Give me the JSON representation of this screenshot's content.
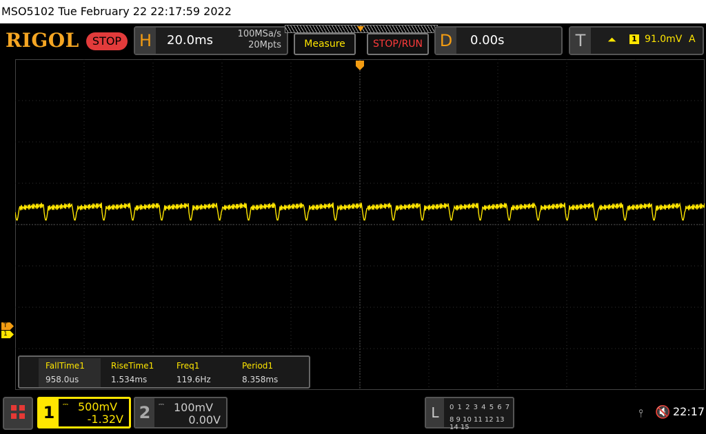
{
  "titlebar": {
    "text": "MSO5102  Tue February 22 22:17:59 2022"
  },
  "header": {
    "logo": "RIGOL",
    "status": "STOP",
    "horizontal": {
      "letter": "H",
      "timebase": "20.0ms",
      "sample_rate": "100MSa/s",
      "memory_depth": "20Mpts"
    },
    "measure_label": "Measure",
    "stoprun_label": "STOP/RUN",
    "delay": {
      "letter": "D",
      "value": "0.00s"
    },
    "trigger": {
      "letter": "T",
      "source": "1",
      "level": "91.0mV",
      "mode": "A"
    }
  },
  "markers": {
    "trigger": "T",
    "channel": "1"
  },
  "measurements": [
    {
      "label": "FallTime1",
      "value": "958.0us"
    },
    {
      "label": "RiseTime1",
      "value": "1.534ms"
    },
    {
      "label": "Freq1",
      "value": "119.6Hz"
    },
    {
      "label": "Period1",
      "value": "8.358ms"
    }
  ],
  "channels": [
    {
      "num": "1",
      "scale": "500mV",
      "offset": "-1.32V"
    },
    {
      "num": "2",
      "scale": "100mV",
      "offset": "0.00V"
    }
  ],
  "logic": {
    "letter": "L",
    "row1": "0 1 2 3  4 5 6 7",
    "row2": "8 9 10 11 12 13 14 15"
  },
  "status_bar": {
    "time": "22:17"
  },
  "colors": {
    "ch1": "#ffe600",
    "accent": "#f39c12",
    "stop": "#e23b3b"
  }
}
